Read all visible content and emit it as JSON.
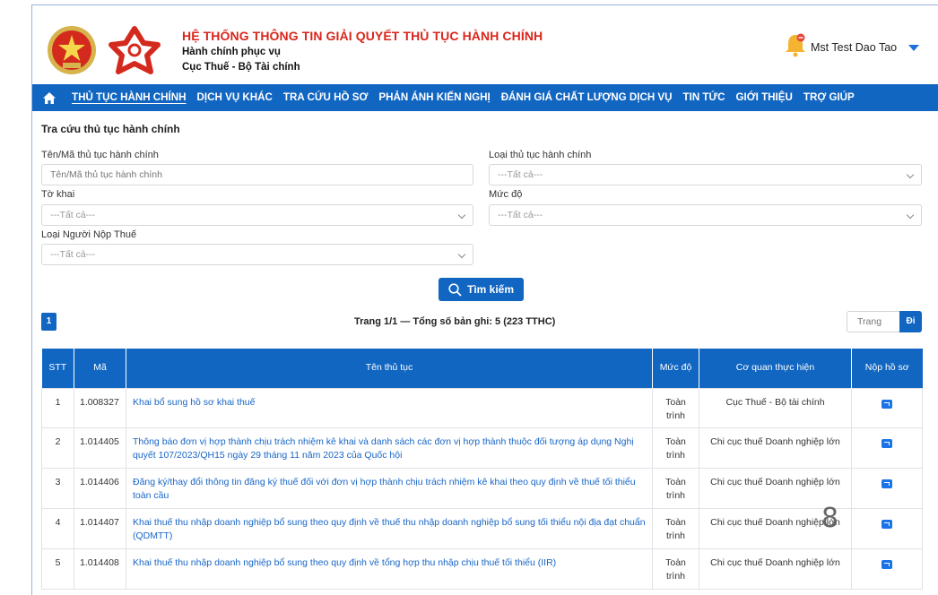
{
  "header": {
    "title": "HỆ THỐNG THÔNG TIN GIẢI QUYẾT THỦ TỤC HÀNH CHÍNH",
    "subtitle1": "Hành chính phục vụ",
    "subtitle2": "Cục Thuế - Bộ Tài chính",
    "user": "Mst Test Dao Tao"
  },
  "nav": {
    "items": [
      "THỦ TỤC HÀNH CHÍNH",
      "DỊCH VỤ KHÁC",
      "TRA CỨU HỒ SƠ",
      "PHẢN ÁNH KIẾN NGHỊ",
      "ĐÁNH GIÁ CHẤT LƯỢNG DỊCH VỤ",
      "TIN TỨC",
      "GIỚI THIỆU",
      "TRỢ GIÚP"
    ]
  },
  "search": {
    "panel_title": "Tra cứu thủ tục hành chính",
    "name_label": "Tên/Mã thủ tục hành chính",
    "name_placeholder": "Tên/Mã thủ tục hành chính",
    "type_label": "Loại thủ tục hành chính",
    "type_value": "---Tất cả---",
    "form_label": "Tờ khai",
    "form_value": "---Tất cả---",
    "level_label": "Mức độ",
    "level_value": "---Tất cả---",
    "taxpayer_label": "Loại Người Nộp Thuế",
    "taxpayer_value": "---Tất cả---",
    "button": "Tìm kiếm"
  },
  "pagination": {
    "current_page": "1",
    "info": "Trang 1/1 — Tổng số bản ghi: 5 (223 TTHC)",
    "goto_placeholder": "Trang",
    "goto_button": "Đi"
  },
  "table": {
    "headers": [
      "STT",
      "Mã",
      "Tên thủ tục",
      "Mức độ",
      "Cơ quan thực hiện",
      "Nộp hồ sơ"
    ],
    "rows": [
      {
        "stt": "1",
        "code": "1.008327",
        "name": "Khai bổ sung hồ sơ khai thuế",
        "level": "Toàn trình",
        "agency": "Cục Thuế - Bộ tài chính"
      },
      {
        "stt": "2",
        "code": "1.014405",
        "name": "Thông báo đơn vị hợp thành chịu trách nhiệm kê khai và danh sách các đơn vị hợp thành thuộc đối tượng áp dụng Nghị quyết 107/2023/QH15 ngày 29 tháng 11 năm 2023 của Quốc hội",
        "level": "Toàn trình",
        "agency": "Chi cục thuế Doanh nghiệp lớn"
      },
      {
        "stt": "3",
        "code": "1.014406",
        "name": "Đăng ký/thay đổi thông tin đăng ký thuế đối với đơn vị hợp thành chịu trách nhiệm kê khai theo quy định về thuế tối thiểu toàn cầu",
        "level": "Toàn trình",
        "agency": "Chi cục thuế Doanh nghiệp lớn"
      },
      {
        "stt": "4",
        "code": "1.014407",
        "name": "Khai thuế thu nhập doanh nghiệp bổ sung theo quy định về thuế thu nhập doanh nghiệp bổ sung tối thiểu nội địa đạt chuẩn (QDMTT)",
        "level": "Toàn trình",
        "agency": "Chi cục thuế Doanh nghiệp lớn"
      },
      {
        "stt": "5",
        "code": "1.014408",
        "name": "Khai thuế thu nhập doanh nghiệp bổ sung theo quy định về tổng hợp thu nhập chịu thuế tối thiểu (IIR)",
        "level": "Toàn trình",
        "agency": "Chi cục thuế Doanh nghiệp lớn"
      }
    ]
  },
  "overlay_text": "8",
  "colors": {
    "primary": "#1166c2",
    "title_red": "#d9261c",
    "link": "#1866c6"
  }
}
